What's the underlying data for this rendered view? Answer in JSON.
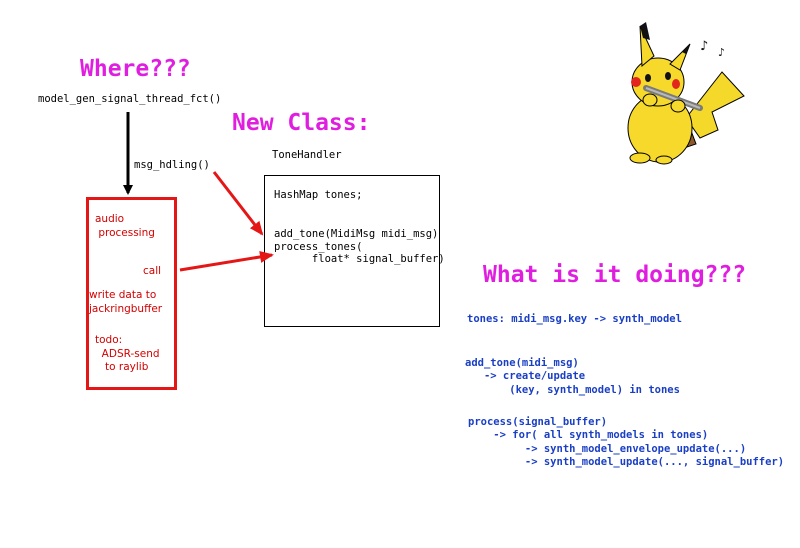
{
  "titles": {
    "where": "Where???",
    "new_class": "New Class:",
    "what": "What is it doing???"
  },
  "labels": {
    "thread_fct": "model_gen_signal_thread_fct()",
    "msg_hdling": "msg_hdling()",
    "class_name": "ToneHandler"
  },
  "audio_box": {
    "audio_processing": "audio\n processing",
    "call": "call",
    "write_data": "write data to\njackringbuffer",
    "todo": "todo:\n  ADSR-send\n   to raylib"
  },
  "class_box": {
    "field": "HashMap tones;",
    "methods": "add_tone(MidiMsg midi_msg)\nprocess_tones(\n      float* signal_buffer)"
  },
  "notes": {
    "tones": "tones: midi_msg.key -> synth_model",
    "add_tone": "add_tone(midi_msg)\n   -> create/update\n       (key, synth_model) in tones",
    "process": "process(signal_buffer)\n    -> for( all synth_models in tones)\n         -> synth_model_envelope_update(...)\n         -> synth_model_update(..., signal_buffer)"
  },
  "colors": {
    "title": "#e01ee0",
    "red": "#e51616",
    "blue": "#1a3fc4"
  }
}
